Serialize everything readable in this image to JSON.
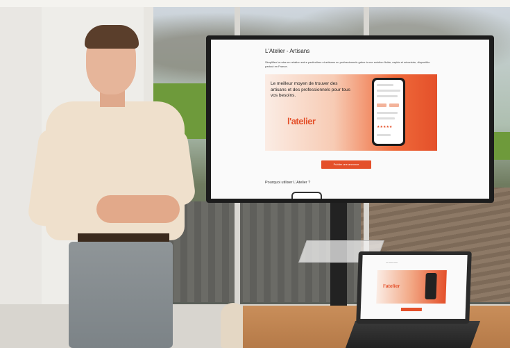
{
  "screen": {
    "title": "L'Atelier - Artisans",
    "description": "Simplifiez la mise en relation entre particuliers et artisans ou professionnels grâce à une solution fluide, rapide et sécurisée, disponible partout en France.",
    "hero_text": "Le meilleur moyen de trouver des artisans et des professionnels pour tous vos besoins.",
    "hero_logo": "l'atelier",
    "cta_label": "Publier une annonce",
    "section_heading": "Pourquoi utiliser L'Atelier ?",
    "stars": "★★★★★"
  },
  "laptop": {
    "hero_logo": "l'atelier"
  },
  "colors": {
    "brand": "#e4502a",
    "hero_light": "#fbece4"
  }
}
